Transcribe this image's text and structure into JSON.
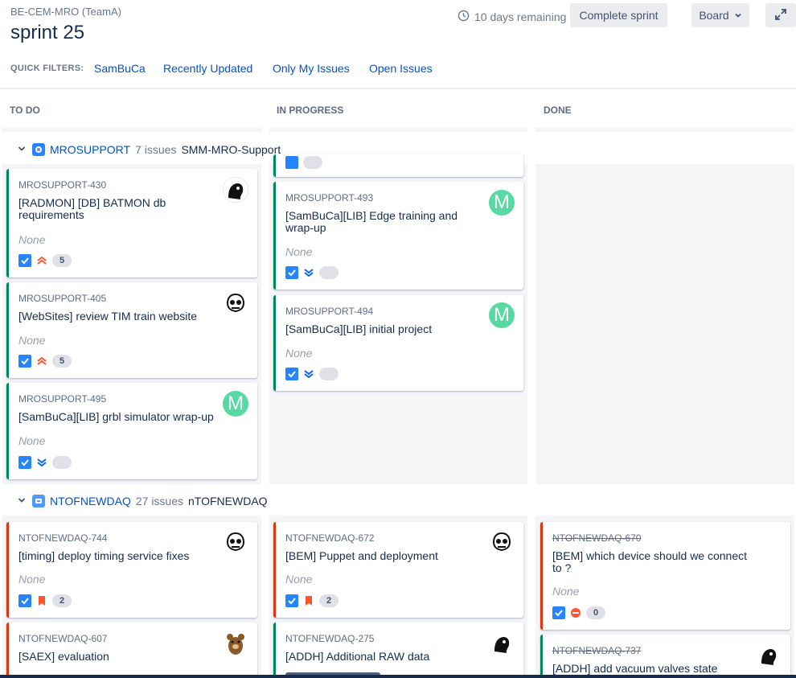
{
  "header": {
    "project": "BE-CEM-MRO (TeamA)",
    "sprint": "sprint 25",
    "remaining": "10 days remaining",
    "complete_label": "Complete sprint",
    "board_label": "Board"
  },
  "quick_filters": {
    "label": "QUICK FILTERS:",
    "items": [
      "SamBuCa",
      "Recently Updated",
      "Only My Issues",
      "Open Issues"
    ]
  },
  "columns": [
    "TO DO",
    "IN PROGRESS",
    "DONE"
  ],
  "swimlanes": [
    {
      "name": "MROSUPPORT",
      "count": "7 issues",
      "desc": "SMM-MRO-Support"
    },
    {
      "name": "NTOFNEWDAQ",
      "count": "27 issues",
      "desc": "nTOFNEWDAQ"
    }
  ],
  "empty_epic": "None",
  "cards": [
    {
      "key": "MROSUPPORT-430",
      "summary": "[RADMON] [DB] BATMON db requirements",
      "estimate": "5",
      "priority": "highest"
    },
    {
      "key": "MROSUPPORT-405",
      "summary": "[WebSites] review TIM train website",
      "estimate": "5",
      "priority": "highest"
    },
    {
      "key": "MROSUPPORT-495",
      "summary": "[SamBuCa][LIB] grbl simulator wrap-up",
      "estimate": "",
      "priority": "lowest"
    },
    {
      "key": "MROSUPPORT-493",
      "summary": "[SamBuCa][LIB] Edge training and wrap-up",
      "estimate": "",
      "priority": "lowest"
    },
    {
      "key": "MROSUPPORT-494",
      "summary": "[SamBuCa][LIB] initial project",
      "estimate": "",
      "priority": "lowest"
    },
    {
      "key": "NTOFNEWDAQ-744",
      "summary": "[timing] deploy timing service fixes",
      "estimate": "2",
      "priority": "flag"
    },
    {
      "key": "NTOFNEWDAQ-672",
      "summary": "[BEM] Puppet and deployment",
      "estimate": "2",
      "priority": "flag"
    },
    {
      "key": "NTOFNEWDAQ-670",
      "summary": "[BEM] which device should we connect to ?",
      "estimate": "0",
      "priority": "blocker"
    },
    {
      "key": "NTOFNEWDAQ-607",
      "summary": "[SAEX] evaluation"
    },
    {
      "key": "NTOFNEWDAQ-275",
      "summary": "[ADDH] Additional RAW data"
    },
    {
      "key": "NTOFNEWDAQ-737",
      "summary": "[ADDH] add vacuum valves state"
    }
  ],
  "avatar_initial": "M",
  "colors": {
    "accent": "#0052cc",
    "done_border": "#00875a",
    "bug_border": "#de350b"
  }
}
